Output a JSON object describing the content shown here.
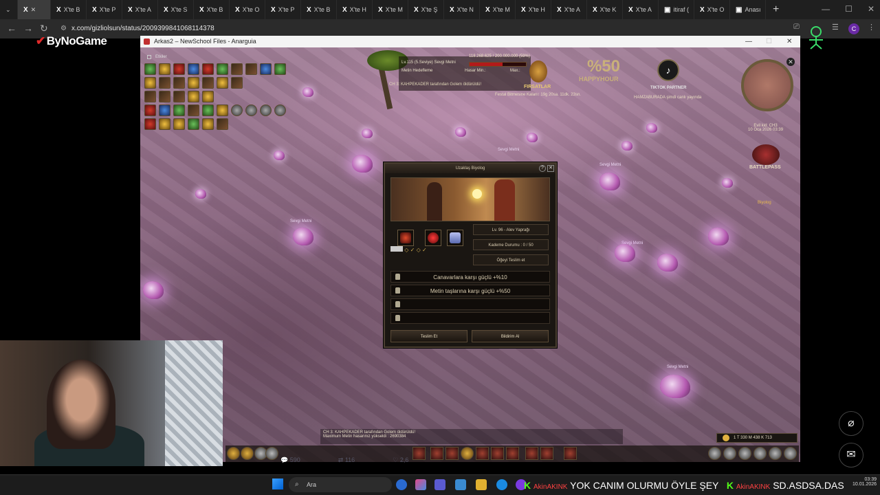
{
  "browser": {
    "tabs": [
      "X'te B",
      "X'te P",
      "X'te A",
      "X'te S",
      "X'te B",
      "X'te O",
      "X'te P",
      "X'te B",
      "X'te H",
      "X'te M",
      "X'te Ş",
      "X'te N",
      "X'te M",
      "X'te H",
      "X'te A",
      "X'te K",
      "X'te A",
      "itiraf (",
      "X'te O",
      "Anası"
    ],
    "new_tab": "+",
    "url": "x.com/gizliolsun/status/2009399841068114378",
    "profile_initial": "C"
  },
  "overlay": {
    "brand": "ByNoGame"
  },
  "game": {
    "window_title": "Arkas2 – NewSchool Files - Anarguia",
    "effects_label": "Etkiler",
    "target": {
      "name": "Lv.115 (5.Seviye) Sevgi Metni",
      "hp_text": "118.268.625 / 200.000.000 (59%)",
      "hp_fraction": 0.59,
      "sub1": "Metin Hedefleme",
      "sub2": "Hasar Min.:",
      "sub3": "Max.:"
    },
    "quest_line": "CH 3: KAHPEKADER tarafından Golem öldürüldü!",
    "firsatlar": "FIRSATLAR",
    "event_time": "Festal Bitmesine Kalanı: 19g 20sa. 11dk. 23sn.",
    "happyhour_value": "%50",
    "happyhour_label": "HAPPYHOUR",
    "tiktok_label": "TIKTOK PARTNER",
    "tiktok_sub": "HAMZABURADA şimdi canlı yayında",
    "map_info_1": "Evil kid: CH3",
    "map_info_2": "10 Oca 2026 03:39",
    "battlepass_label": "BATTLEPASS",
    "biyolog_side": "Biyolog",
    "metin_label": "Sevgi Metni",
    "dialog": {
      "title": "Uzaklaş Biyolog",
      "level_info": "Lv. 96 - Alev Yaprağı",
      "progress_info": "Kademe Durumu : 0 / 50",
      "deliver_item": "Öğeyi Teslim et",
      "bonuses": [
        "Canavarlara karşı güçlü +%10",
        "Metin taşlarına karşı güçlü +%50",
        "",
        ""
      ],
      "btn_deliver": "Teslim Et",
      "btn_reward": "Bildirim Al"
    },
    "chat_lines": [
      "CH 3: KAHPEKADER tarafından Golem öldürüldü!",
      "Maximum Metin hasarınız yükseldi : 2690384"
    ],
    "money": "1 T 330 M 438 K 713"
  },
  "x_stats": {
    "replies": "590",
    "reposts": "116",
    "likes": "2,6"
  },
  "windows": {
    "search_placeholder": "Ara",
    "ticker_kick": "K",
    "ticker_name": "AkinAKINK",
    "ticker_text": "YOK CANIM OLURMU ÖYLE ŞEY",
    "ticker_name2": "AkinAKINK",
    "ticker_text2": "SD.ASDSA.DAS",
    "clock_time": "03:39",
    "clock_date": "10.01.2026"
  }
}
